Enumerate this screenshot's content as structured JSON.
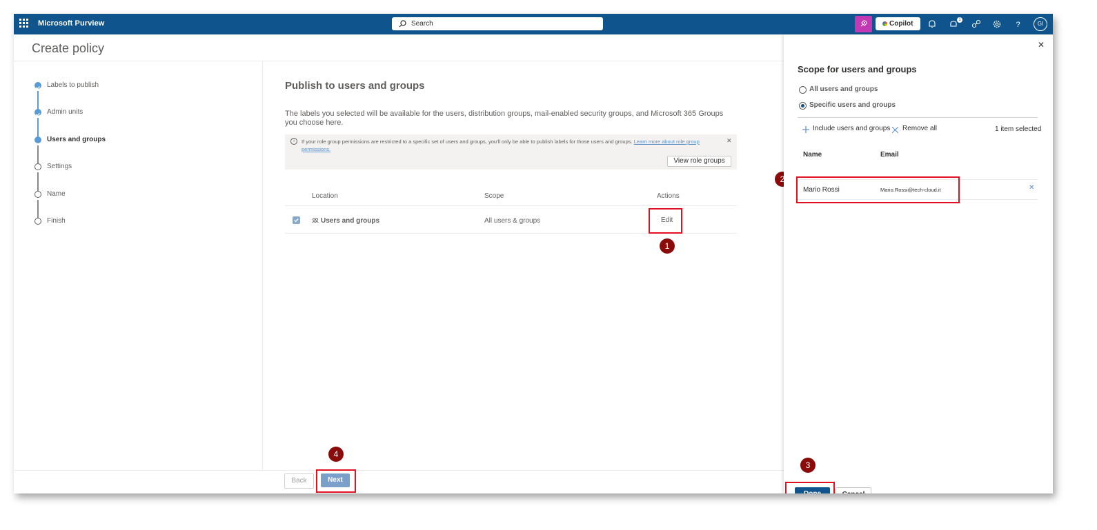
{
  "app": {
    "name": "Microsoft Purview"
  },
  "search": {
    "placeholder": "Search"
  },
  "topbar": {
    "copilot_label": "Copilot",
    "notification_count": "1",
    "avatar_initials": "GI"
  },
  "page": {
    "title": "Create policy"
  },
  "steps": [
    {
      "label": "Labels to publish",
      "state": "done"
    },
    {
      "label": "Admin units",
      "state": "done"
    },
    {
      "label": "Users and groups",
      "state": "current"
    },
    {
      "label": "Settings",
      "state": "todo"
    },
    {
      "label": "Name",
      "state": "todo"
    },
    {
      "label": "Finish",
      "state": "todo"
    }
  ],
  "main": {
    "heading": "Publish to users and groups",
    "description": "The labels you selected will be available for the users, distribution groups, mail-enabled security groups, and Microsoft 365 Groups you choose here.",
    "info": {
      "text": "If your role group permissions are restricted to a specific set of users and groups, you'll only be able to publish labels for those users and groups.",
      "link": "Learn more about role group permissions.",
      "button": "View role groups"
    },
    "table": {
      "headers": {
        "location": "Location",
        "scope": "Scope",
        "actions": "Actions"
      },
      "row": {
        "location": "Users and groups",
        "scope": "All users & groups",
        "action": "Edit"
      }
    },
    "back_label": "Back",
    "next_label": "Next"
  },
  "panel": {
    "title": "Scope for users and groups",
    "options": [
      "All users and groups",
      "Specific users and groups"
    ],
    "selected_option": "Specific users and groups",
    "include_label": "Include users and groups",
    "remove_label": "Remove all",
    "selected_count": "1 item selected",
    "headers": {
      "name": "Name",
      "email": "Email"
    },
    "row": {
      "name": "Mario Rossi",
      "email": "Mario.Rossi@tech-cloud.it"
    },
    "done_label": "Done",
    "cancel_label": "Cancel"
  },
  "annotations": {
    "m1": "1",
    "m2": "2",
    "m3": "3",
    "m4": "4"
  },
  "colors": {
    "topbar": "#0f548c",
    "accent": "#5b9bd5",
    "highlight": "#e3101f",
    "marker": "#8b0a0a"
  }
}
